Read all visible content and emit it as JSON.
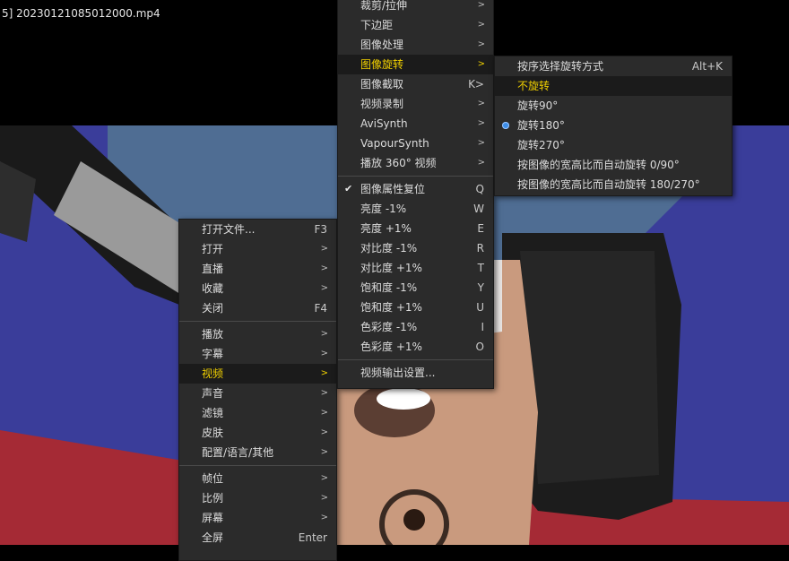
{
  "window": {
    "title": "5] 20230121085012000.mp4"
  },
  "menu_main": [
    {
      "label": "打开文件...",
      "shortcut": "F3"
    },
    {
      "label": "打开",
      "sub": true
    },
    {
      "label": "直播",
      "sub": true
    },
    {
      "label": "收藏",
      "sub": true
    },
    {
      "label": "关闭",
      "shortcut": "F4"
    },
    {
      "sep": true
    },
    {
      "label": "播放",
      "sub": true
    },
    {
      "label": "字幕",
      "sub": true
    },
    {
      "label": "视频",
      "sub": true,
      "active": true
    },
    {
      "label": "声音",
      "sub": true
    },
    {
      "label": "滤镜",
      "sub": true
    },
    {
      "label": "皮肤",
      "sub": true
    },
    {
      "label": "配置/语言/其他",
      "sub": true
    },
    {
      "sep": true
    },
    {
      "label": "帧位",
      "sub": true
    },
    {
      "label": "比例",
      "sub": true
    },
    {
      "label": "屏幕",
      "sub": true
    },
    {
      "label": "全屏",
      "shortcut": "Enter"
    }
  ],
  "menu_video": [
    {
      "label": "裁剪/拉伸",
      "sub": true
    },
    {
      "label": "下边距",
      "sub": true
    },
    {
      "label": "图像处理",
      "sub": true
    },
    {
      "label": "图像旋转",
      "sub": true,
      "active": true
    },
    {
      "label": "图像截取",
      "shortcut": "K>"
    },
    {
      "label": "视频录制",
      "sub": true
    },
    {
      "label": "AviSynth",
      "sub": true
    },
    {
      "label": "VapourSynth",
      "sub": true
    },
    {
      "label": "播放 360° 视频",
      "sub": true
    },
    {
      "sep": true
    },
    {
      "label": "图像属性复位",
      "shortcut": "Q",
      "checked": true
    },
    {
      "label": "亮度 -1%",
      "shortcut": "W"
    },
    {
      "label": "亮度 +1%",
      "shortcut": "E"
    },
    {
      "label": "对比度 -1%",
      "shortcut": "R"
    },
    {
      "label": "对比度 +1%",
      "shortcut": "T"
    },
    {
      "label": "饱和度 -1%",
      "shortcut": "Y"
    },
    {
      "label": "饱和度 +1%",
      "shortcut": "U"
    },
    {
      "label": "色彩度 -1%",
      "shortcut": "I"
    },
    {
      "label": "色彩度 +1%",
      "shortcut": "O"
    },
    {
      "sep": true
    },
    {
      "label": "视频输出设置..."
    }
  ],
  "menu_rotate": [
    {
      "label": "按序选择旋转方式",
      "shortcut": "Alt+K"
    },
    {
      "label": "不旋转",
      "active": true
    },
    {
      "label": "旋转90°"
    },
    {
      "label": "旋转180°",
      "radio": true
    },
    {
      "label": "旋转270°"
    },
    {
      "label": "按图像的宽高比而自动旋转 0/90°"
    },
    {
      "label": "按图像的宽高比而自动旋转 180/270°"
    }
  ]
}
